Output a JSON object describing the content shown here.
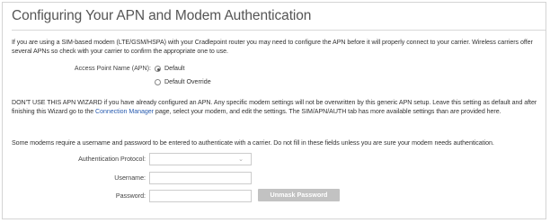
{
  "page": {
    "title": "Configuring Your APN and Modem Authentication"
  },
  "intro": {
    "text": "If you are using a SIM-based modem (LTE/GSM/HSPA) with your Cradlepoint router you may need to configure the APN before it will properly connect to your carrier. Wireless carriers offer several APNs so check with your carrier to confirm the appropriate one to use."
  },
  "apn": {
    "label": "Access Point Name (APN):",
    "options": [
      {
        "label": "Default",
        "selected": true
      },
      {
        "label": "Default Override",
        "selected": false
      }
    ]
  },
  "warning": {
    "text_before": "DON'T USE THIS APN WIZARD if you have already configured an APN. Any specific modem settings will not be overwritten by this generic APN setup. Leave this setting as default and after finishing this Wizard go to the ",
    "link": "Connection Manager",
    "text_after": " page, select your modem, and edit the settings. The SIM/APN/AUTH tab has more available settings than are provided here."
  },
  "auth_note": {
    "text": "Some modems require a username and password to be entered to authenticate with a carrier. Do not fill in these fields unless you are sure your modem needs authentication."
  },
  "form": {
    "protocol_label": "Authentication Protocol:",
    "protocol_value": "",
    "username_label": "Username:",
    "username_value": "",
    "password_label": "Password:",
    "password_value": "",
    "unmask_label": "Unmask Password"
  },
  "colors": {
    "link": "#2a5db0",
    "button_disabled": "#c2c2c2"
  }
}
